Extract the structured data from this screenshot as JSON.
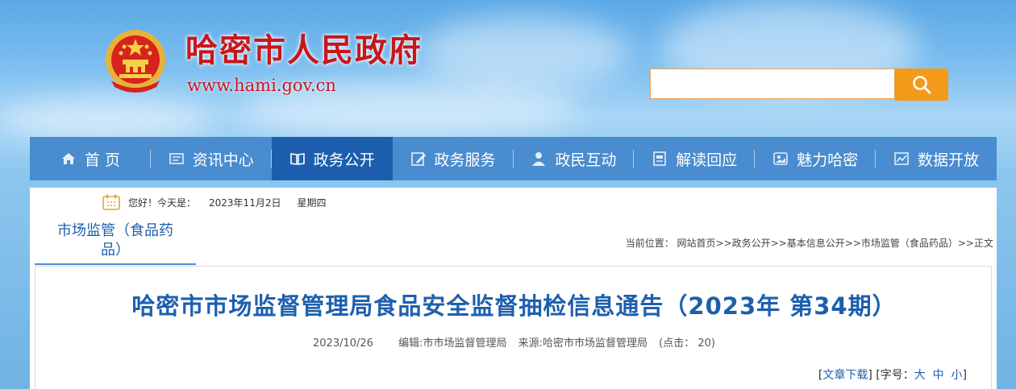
{
  "site": {
    "title": "哈密市人民政府",
    "url": "www.hami.gov.cn",
    "search_placeholder": ""
  },
  "nav": [
    {
      "label": "首 页",
      "icon": "home-icon"
    },
    {
      "label": "资讯中心",
      "icon": "news-icon"
    },
    {
      "label": "政务公开",
      "icon": "book-icon",
      "active": true
    },
    {
      "label": "政务服务",
      "icon": "edit-icon"
    },
    {
      "label": "政民互动",
      "icon": "user-icon"
    },
    {
      "label": "解读回应",
      "icon": "document-icon"
    },
    {
      "label": "魅力哈密",
      "icon": "landscape-icon"
    },
    {
      "label": "数据开放",
      "icon": "chart-icon"
    }
  ],
  "greeting": {
    "text": "您好！今天是：",
    "date": "2023年11月2日",
    "weekday": "星期四"
  },
  "column_tab": {
    "line1": "市场监管（食品药",
    "line2": "品）"
  },
  "breadcrumb": {
    "prefix": "当前位置：",
    "path": "网站首页>>政务公开>>基本信息公开>>市场监管（食品药品）>>正文"
  },
  "article": {
    "title": "哈密市市场监督管理局食品安全监督抽检信息通告（2023年 第34期）",
    "date": "2023/10/26",
    "editor": "编辑:市市场监督管理局",
    "source": "来源:哈密市市场监督管理局",
    "clicks": "(点击： 20)"
  },
  "tools": {
    "download": "文章下载",
    "font_label": "字号：",
    "large": "大",
    "medium": "中",
    "small": "小"
  },
  "colors": {
    "nav_bg": "#4a8cd0",
    "nav_active": "#1d5fae",
    "title_red": "#c8161d",
    "search_orange": "#f39a1b"
  }
}
